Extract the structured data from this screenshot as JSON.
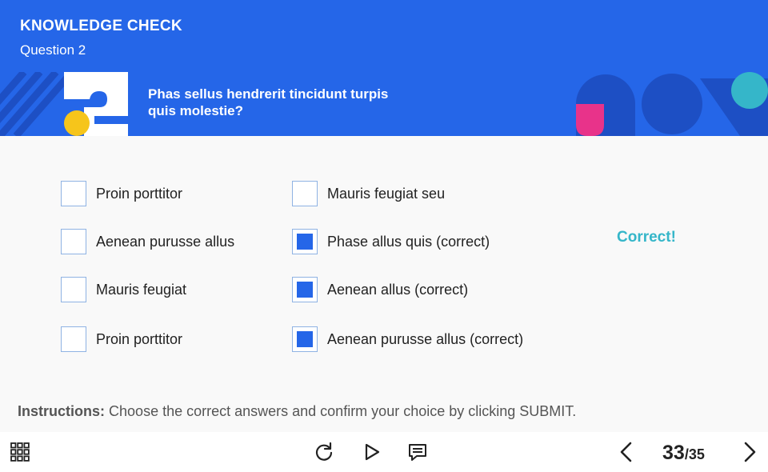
{
  "header": {
    "title": "KNOWLEDGE CHECK",
    "question_number": "Question 2",
    "question_text": "Phas sellus hendrerit tincidunt turpis quis molestie?"
  },
  "options": [
    {
      "label": "Proin porttitor",
      "checked": false
    },
    {
      "label": "Aenean purusse allus",
      "checked": false
    },
    {
      "label": "Mauris feugiat",
      "checked": false
    },
    {
      "label": "Proin porttitor",
      "checked": false
    },
    {
      "label": "Mauris feugiat seu",
      "checked": false
    },
    {
      "label": "Phase allus quis (correct)",
      "checked": true
    },
    {
      "label": "Aenean allus (correct)",
      "checked": true
    },
    {
      "label": "Aenean purusse allus (correct)",
      "checked": true
    }
  ],
  "feedback": "Correct!",
  "instructions": {
    "prefix": "Instructions:",
    "text": "Choose the correct answers and confirm your choice by clicking SUBMIT."
  },
  "footer": {
    "page_current": "33",
    "page_separator": "/",
    "page_total": "35",
    "icons": [
      "grid-menu-icon",
      "replay-icon",
      "play-icon",
      "transcript-icon",
      "prev-icon",
      "next-icon"
    ]
  },
  "colors": {
    "header_bg": "#2566e8",
    "accent_yellow": "#f6c51b",
    "accent_pink": "#e8338a",
    "accent_teal": "#35b6c9",
    "shape_dark_blue": "#1d4fc4",
    "checkbox_fill": "#2566e8",
    "feedback_text": "#35b6c9"
  }
}
